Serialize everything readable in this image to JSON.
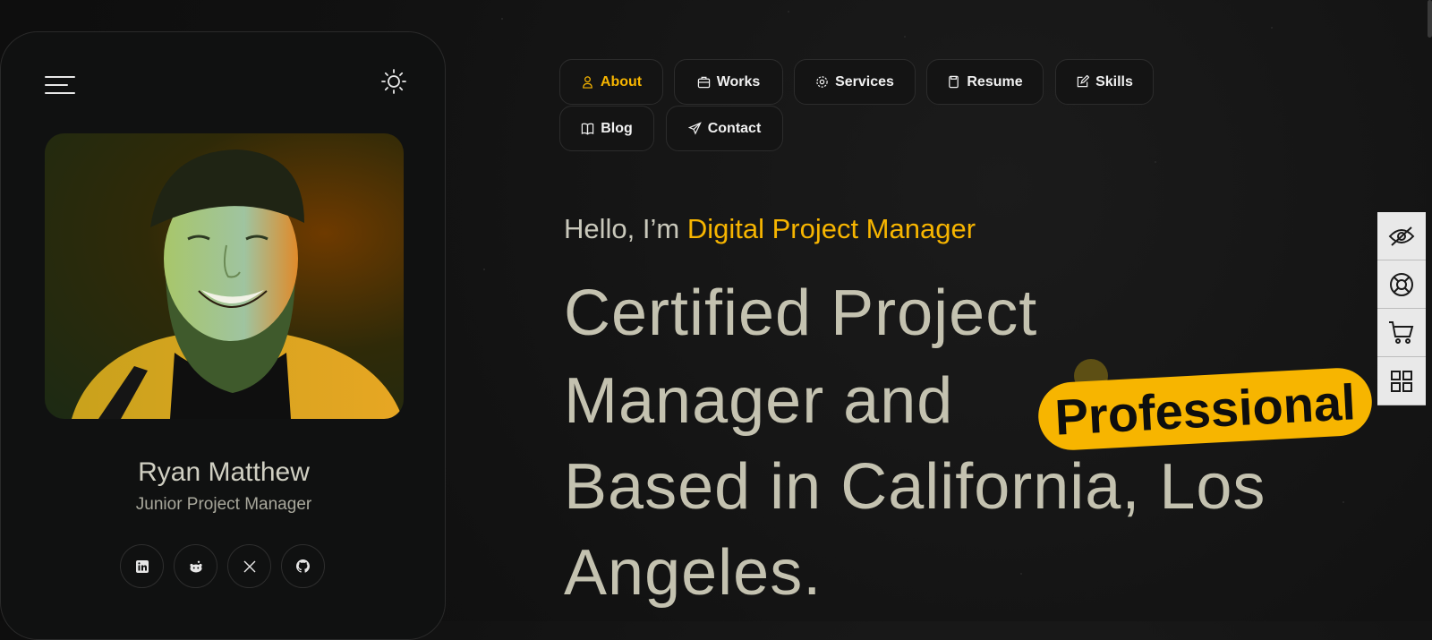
{
  "profile": {
    "name": "Ryan Matthew",
    "title": "Junior Project Manager",
    "photo": "portrait-photo",
    "socials": [
      {
        "icon": "linkedin-icon"
      },
      {
        "icon": "reddit-icon"
      },
      {
        "icon": "x-twitter-icon"
      },
      {
        "icon": "github-icon"
      }
    ]
  },
  "nav": {
    "items": [
      {
        "label": "About",
        "icon": "user-icon",
        "active": true
      },
      {
        "label": "Works",
        "icon": "briefcase-icon"
      },
      {
        "label": "Services",
        "icon": "gear-icon"
      },
      {
        "label": "Resume",
        "icon": "document-icon"
      },
      {
        "label": "Skills",
        "icon": "edit-icon"
      },
      {
        "label": "Blog",
        "icon": "book-icon"
      },
      {
        "label": "Contact",
        "icon": "send-icon"
      }
    ]
  },
  "hero": {
    "greeting": "Hello, I’m",
    "role": "Digital Project Manager",
    "line1": "Certified Project",
    "line2": "Manager and",
    "badge": "Professional",
    "line3": "Based in California, Los",
    "line4": "Angeles."
  },
  "rail": {
    "items": [
      {
        "icon": "eye-off-icon"
      },
      {
        "icon": "lifebuoy-icon"
      },
      {
        "icon": "cart-icon"
      },
      {
        "icon": "grid-icon"
      }
    ]
  },
  "colors": {
    "accent": "#f7b500",
    "background": "#121212",
    "text": "#c4c2b0"
  }
}
